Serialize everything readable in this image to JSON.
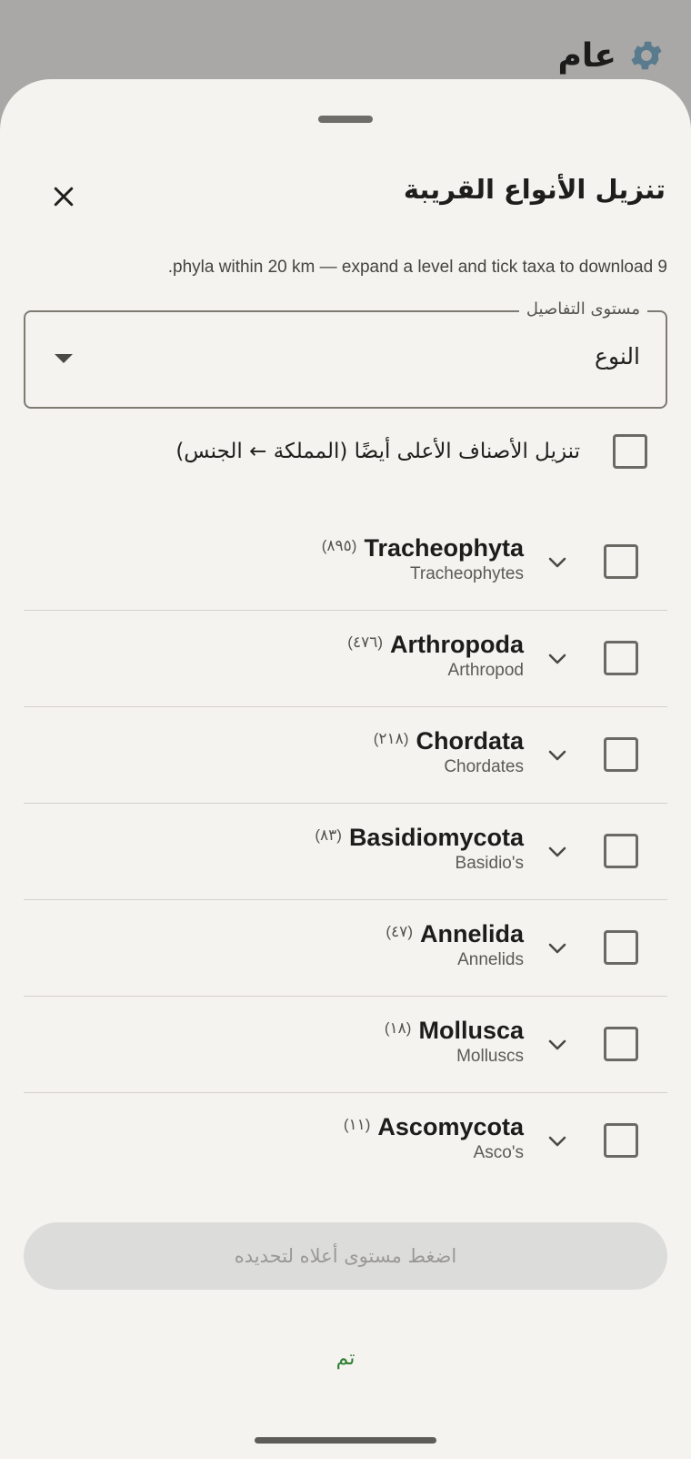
{
  "backdrop": {
    "title": "عام",
    "icon": "gear-icon"
  },
  "sheet": {
    "title": "تنزيل الأنواع القريبة",
    "close_icon": "close-icon",
    "subtitle": "9 phyla within 20 km — expand a level and tick taxa to download.",
    "detail_level": {
      "label": "مستوى التفاصيل",
      "value": "النوع"
    },
    "also_higher_label": "تنزيل الأصناف الأعلى أيضًا (المملكة ← الجنس)",
    "taxa": [
      {
        "name": "Tracheophyta",
        "count": "(٨٩٥)",
        "common": "Tracheophytes"
      },
      {
        "name": "Arthropoda",
        "count": "(٤٧٦)",
        "common": "Arthropod"
      },
      {
        "name": "Chordata",
        "count": "(٢١٨)",
        "common": "Chordates"
      },
      {
        "name": "Basidiomycota",
        "count": "(٨٣)",
        "common": "Basidio's"
      },
      {
        "name": "Annelida",
        "count": "(٤٧)",
        "common": "Annelids"
      },
      {
        "name": "Mollusca",
        "count": "(١٨)",
        "common": "Molluscs"
      },
      {
        "name": "Ascomycota",
        "count": "(١١)",
        "common": "Asco's"
      }
    ],
    "action_button_label": "اضغط مستوى أعلاه لتحديده",
    "done_label": "تم"
  },
  "colors": {
    "accent": "#2e7d32",
    "sheet_bg": "#f4f3ef",
    "scrim": "#a9a8a6"
  }
}
